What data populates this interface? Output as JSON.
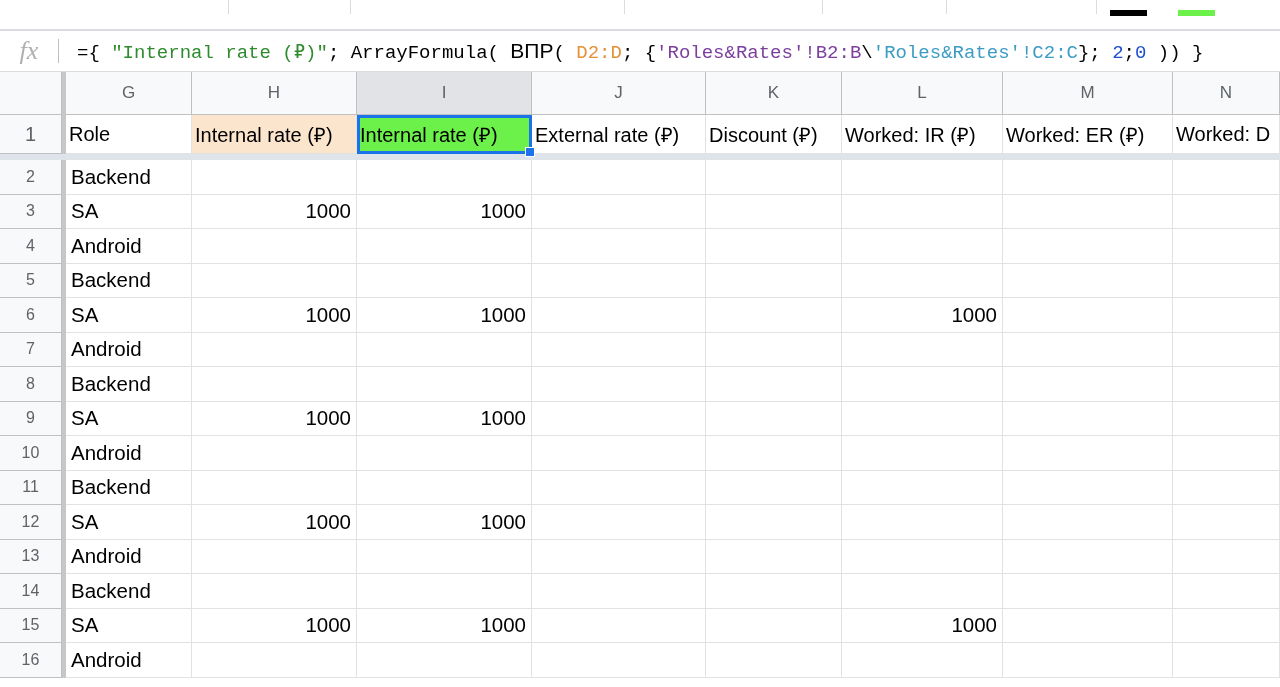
{
  "formula_bar": {
    "label": "fx",
    "segments": [
      {
        "kind": "plain",
        "text": "={ "
      },
      {
        "kind": "string",
        "text": "\"Internal rate (₽)\""
      },
      {
        "kind": "plain",
        "text": "; ArrayFormula( "
      },
      {
        "kind": "function",
        "text": "ВПР"
      },
      {
        "kind": "plain",
        "text": "( "
      },
      {
        "kind": "ref",
        "color": "#e69138",
        "text": "D2:D"
      },
      {
        "kind": "plain",
        "text": "; {"
      },
      {
        "kind": "ref",
        "color": "#7b3f9e",
        "text": "'Roles&Rates'!B2:B"
      },
      {
        "kind": "plain",
        "text": "\\"
      },
      {
        "kind": "ref",
        "color": "#3d9cc4",
        "text": "'Roles&Rates'!C2:C"
      },
      {
        "kind": "plain",
        "text": "}; "
      },
      {
        "kind": "number",
        "text": "2"
      },
      {
        "kind": "plain",
        "text": ";"
      },
      {
        "kind": "number",
        "text": "0"
      },
      {
        "kind": "plain",
        "text": " )) }"
      }
    ]
  },
  "columns": [
    {
      "letter": "G",
      "selected": false
    },
    {
      "letter": "H",
      "selected": false
    },
    {
      "letter": "I",
      "selected": true
    },
    {
      "letter": "J",
      "selected": false
    },
    {
      "letter": "K",
      "selected": false
    },
    {
      "letter": "L",
      "selected": false
    },
    {
      "letter": "M",
      "selected": false
    },
    {
      "letter": "N",
      "selected": false
    }
  ],
  "header_row": {
    "number": "1",
    "cells": [
      {
        "text": "Role",
        "color": "#ffffff",
        "selected": false
      },
      {
        "text": "Internal rate (₽)",
        "color": "#fce5cd",
        "selected": false
      },
      {
        "text": "Internal rate (₽)",
        "color": "#6cf04a",
        "selected": true
      },
      {
        "text": "External rate (₽)",
        "color": "#ffffff",
        "selected": false
      },
      {
        "text": "Discount (₽)",
        "color": "#ffffff",
        "selected": false
      },
      {
        "text": "Worked: IR (₽)",
        "color": "#ffffff",
        "selected": false
      },
      {
        "text": "Worked: ER (₽)",
        "color": "#ffffff",
        "selected": false
      },
      {
        "text": "Worked: D",
        "color": "#ffffff",
        "selected": false
      }
    ]
  },
  "rows": [
    {
      "number": "2",
      "cells": [
        "Backend",
        "",
        "",
        "",
        "",
        "",
        "",
        ""
      ]
    },
    {
      "number": "3",
      "cells": [
        "SA",
        "1000",
        "1000",
        "",
        "",
        "",
        "",
        ""
      ]
    },
    {
      "number": "4",
      "cells": [
        "Android",
        "",
        "",
        "",
        "",
        "",
        "",
        ""
      ]
    },
    {
      "number": "5",
      "cells": [
        "Backend",
        "",
        "",
        "",
        "",
        "",
        "",
        ""
      ]
    },
    {
      "number": "6",
      "cells": [
        "SA",
        "1000",
        "1000",
        "",
        "",
        "1000",
        "",
        ""
      ]
    },
    {
      "number": "7",
      "cells": [
        "Android",
        "",
        "",
        "",
        "",
        "",
        "",
        ""
      ]
    },
    {
      "number": "8",
      "cells": [
        "Backend",
        "",
        "",
        "",
        "",
        "",
        "",
        ""
      ]
    },
    {
      "number": "9",
      "cells": [
        "SA",
        "1000",
        "1000",
        "",
        "",
        "",
        "",
        ""
      ]
    },
    {
      "number": "10",
      "cells": [
        "Android",
        "",
        "",
        "",
        "",
        "",
        "",
        ""
      ]
    },
    {
      "number": "11",
      "cells": [
        "Backend",
        "",
        "",
        "",
        "",
        "",
        "",
        ""
      ]
    },
    {
      "number": "12",
      "cells": [
        "SA",
        "1000",
        "1000",
        "",
        "",
        "",
        "",
        ""
      ]
    },
    {
      "number": "13",
      "cells": [
        "Android",
        "",
        "",
        "",
        "",
        "",
        "",
        ""
      ]
    },
    {
      "number": "14",
      "cells": [
        "Backend",
        "",
        "",
        "",
        "",
        "",
        "",
        ""
      ]
    },
    {
      "number": "15",
      "cells": [
        "SA",
        "1000",
        "1000",
        "",
        "",
        "1000",
        "",
        ""
      ]
    },
    {
      "number": "16",
      "cells": [
        "Android",
        "",
        "",
        "",
        "",
        "",
        "",
        ""
      ]
    }
  ]
}
